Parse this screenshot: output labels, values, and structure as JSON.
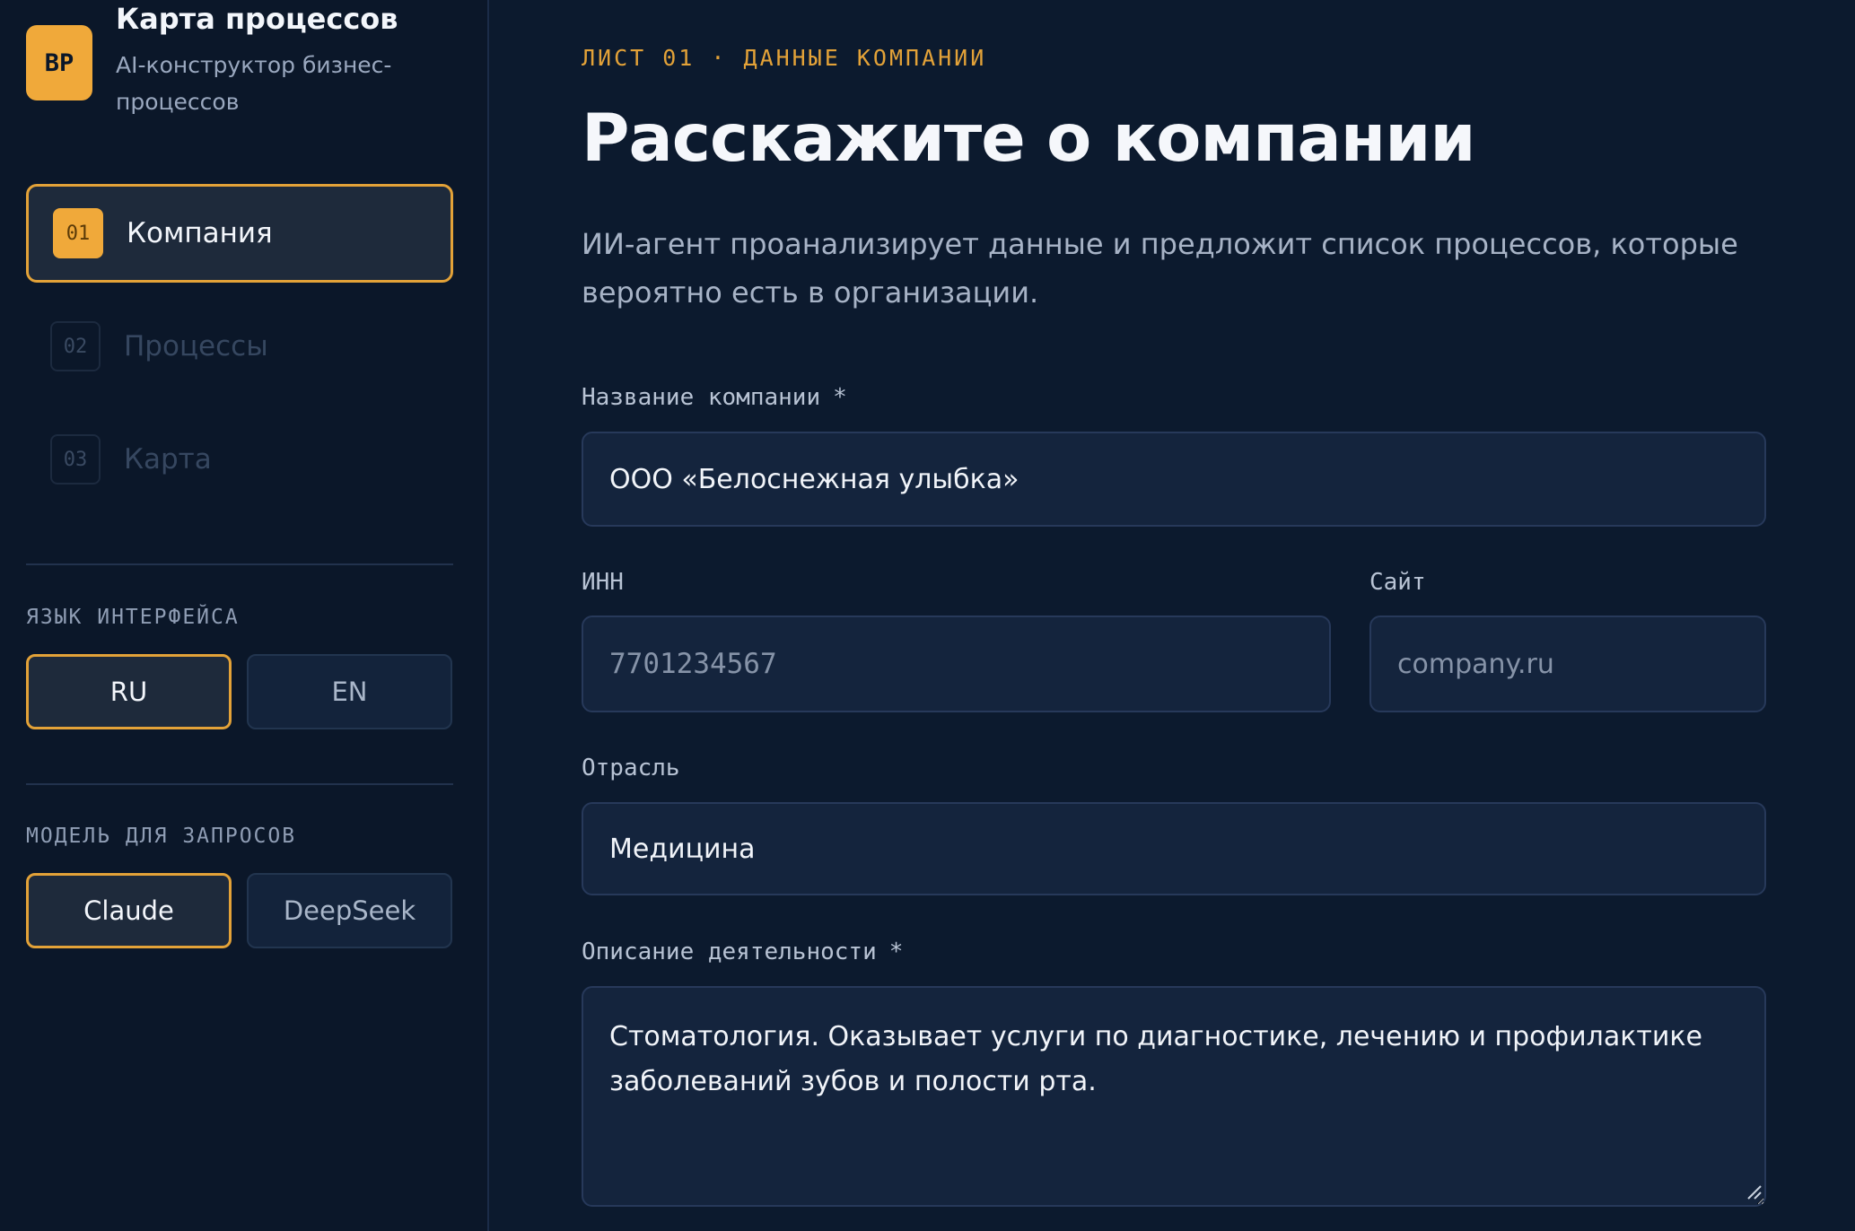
{
  "brand": {
    "logo_text": "BP",
    "title": "Карта процессов",
    "subtitle": "AI-конструктор бизнес-процессов"
  },
  "steps": [
    {
      "num": "01",
      "label": "Компания",
      "active": true
    },
    {
      "num": "02",
      "label": "Процессы",
      "active": false
    },
    {
      "num": "03",
      "label": "Карта",
      "active": false
    }
  ],
  "language": {
    "label": "ЯЗЫК ИНТЕРФЕЙСА",
    "options": [
      "RU",
      "EN"
    ],
    "selected": "RU"
  },
  "model": {
    "label": "МОДЕЛЬ ДЛЯ ЗАПРОСОВ",
    "options": [
      "Claude",
      "DeepSeek"
    ],
    "selected": "Claude"
  },
  "main": {
    "eyebrow": "ЛИСТ 01 · ДАННЫЕ КОМПАНИИ",
    "title": "Расскажите о компании",
    "description": "ИИ-агент проанализирует данные и предложит список процессов, которые вероятно есть в организации."
  },
  "form": {
    "company_name": {
      "label": "Название компании",
      "required_mark": "*",
      "value": "ООО «Белоснежная улыбка»"
    },
    "inn": {
      "label": "ИНН",
      "placeholder": "7701234567",
      "value": ""
    },
    "site": {
      "label": "Сайт",
      "placeholder": "company.ru",
      "value": ""
    },
    "industry": {
      "label": "Отрасль",
      "value": "Медицина"
    },
    "description": {
      "label": "Описание деятельности",
      "required_mark": "*",
      "value": "Стоматология. Оказывает услуги по диагностике, лечению и профилактике заболеваний зубов и полости рта."
    }
  },
  "colors": {
    "accent": "#e3a238",
    "background": "#0c1a2e",
    "sidebar": "#0b1729",
    "input_bg": "#14243d"
  }
}
